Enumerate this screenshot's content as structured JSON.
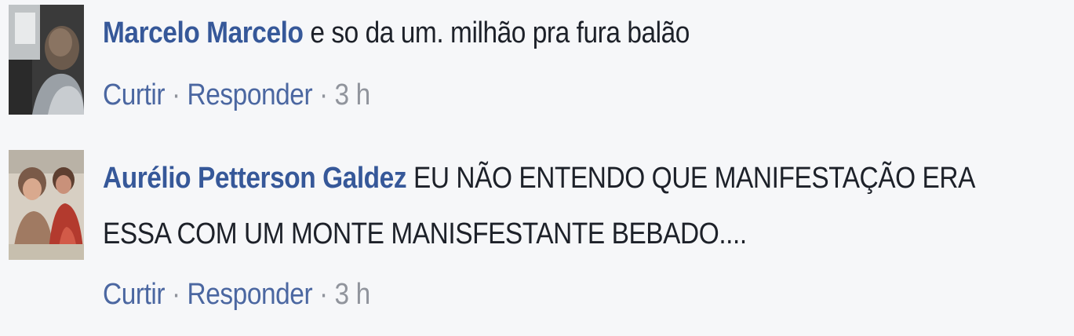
{
  "comments": [
    {
      "author": "Marcelo Marcelo",
      "text_lines": [
        "e so da um. milhão pra fura balão"
      ],
      "actions": {
        "like": "Curtir",
        "reply": "Responder",
        "separator": "·",
        "time": "3 h"
      }
    },
    {
      "author": "Aurélio Petterson Galdez",
      "text_lines": [
        "EU NÃO ENTENDO QUE MANIFESTAÇÃO ERA",
        "ESSA COM UM MONTE MANISFESTANTE BEBADO...."
      ],
      "actions": {
        "like": "Curtir",
        "reply": "Responder",
        "separator": "·",
        "time": "3 h"
      }
    }
  ]
}
